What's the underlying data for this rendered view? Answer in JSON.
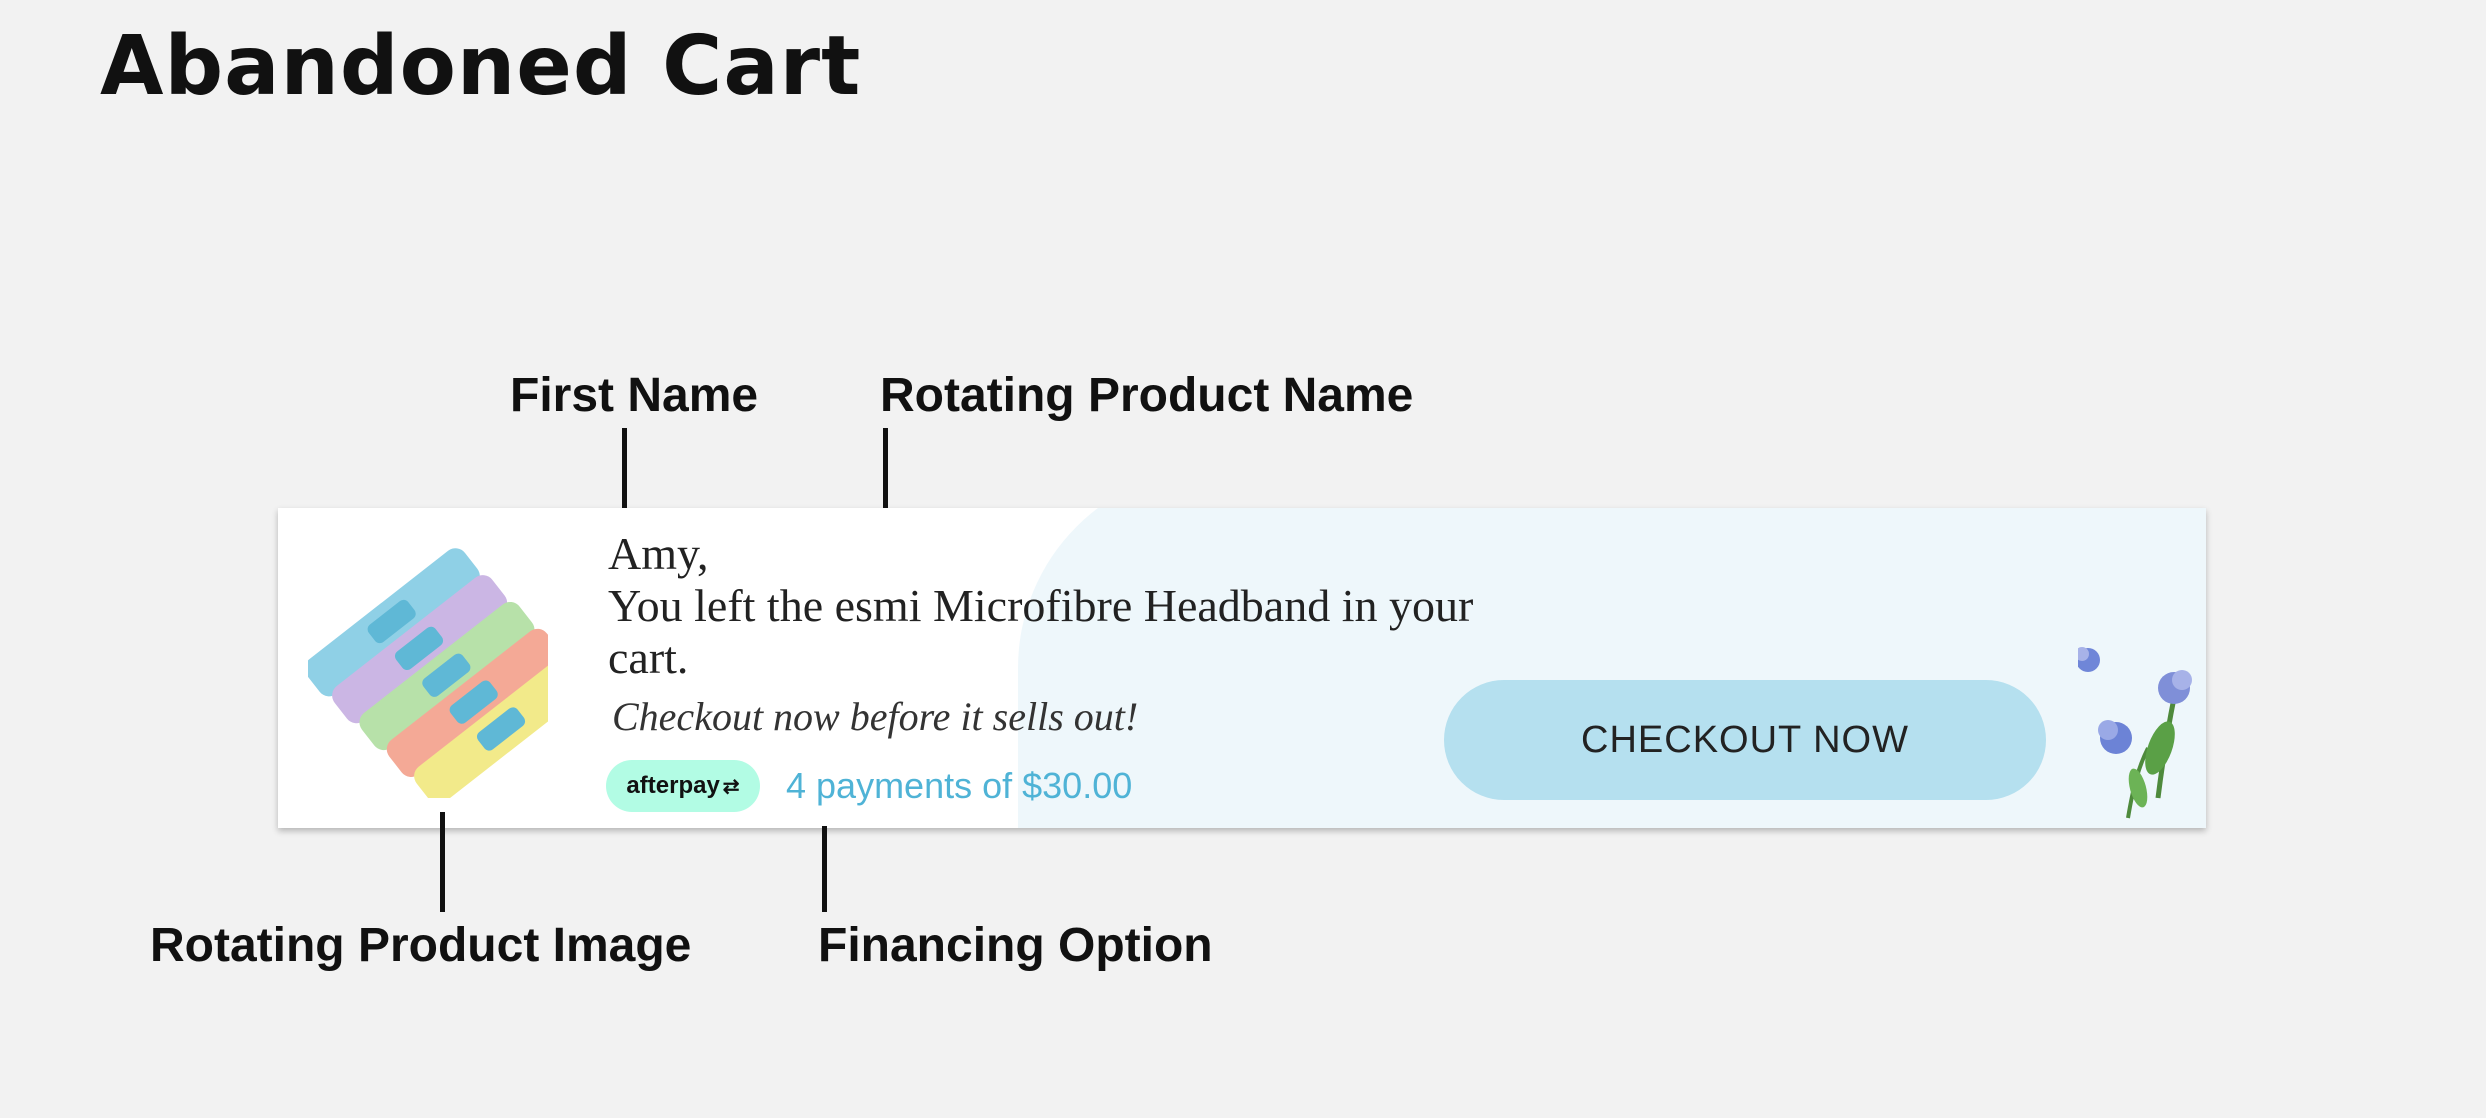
{
  "page": {
    "title": "Abandoned Cart"
  },
  "callouts": {
    "first_name": "First Name",
    "rotating_product_name": "Rotating Product Name",
    "rotating_product_image": "Rotating Product Image",
    "financing_option": "Financing Option"
  },
  "banner": {
    "greeting_name": "Amy,",
    "message_line1": "You left the esmi Microfibre Headband in your",
    "message_line2": "cart.",
    "tagline": "Checkout now before it sells out!",
    "afterpay_logo_text": "afterpay",
    "financing_text": "4 payments of $30.00",
    "checkout_button_label": "CHECKOUT NOW",
    "product_image_icon": "headband-stack-image",
    "decor_icon": "blue-flowers-illustration"
  },
  "colors": {
    "page_background": "#f2f2f2",
    "button": "#b5e0ef",
    "afterpay_mint": "#b2fce4",
    "financing_text": "#4fb3d6"
  }
}
